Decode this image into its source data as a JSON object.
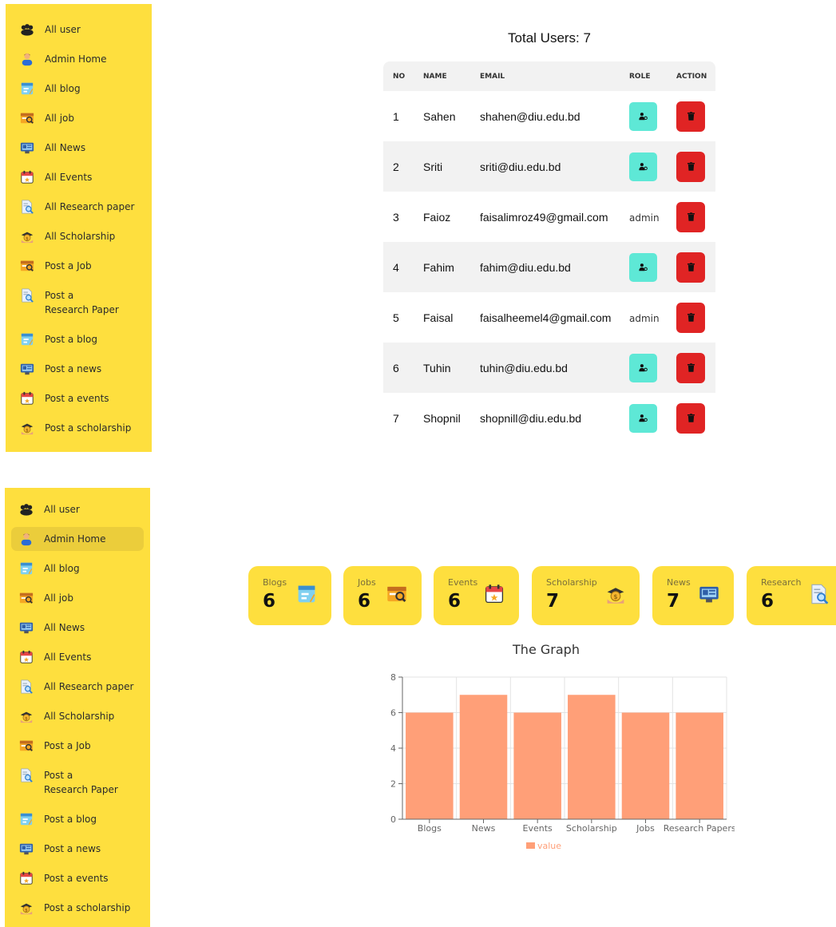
{
  "sidebar_top": {
    "items": [
      {
        "label": "All user",
        "icon": "users-group-icon"
      },
      {
        "label": "Admin Home",
        "icon": "admin-person-icon"
      },
      {
        "label": "All blog",
        "icon": "blog-icon"
      },
      {
        "label": "All job",
        "icon": "job-icon"
      },
      {
        "label": "All News",
        "icon": "news-icon"
      },
      {
        "label": "All Events",
        "icon": "calendar-icon"
      },
      {
        "label": "All Research paper",
        "icon": "research-icon"
      },
      {
        "label": "All Scholarship",
        "icon": "scholarship-icon"
      },
      {
        "label": "Post a Job",
        "icon": "job-icon"
      },
      {
        "label": "Post a Research Paper",
        "icon": "research-icon"
      },
      {
        "label": "Post a blog",
        "icon": "blog-icon"
      },
      {
        "label": "Post a news",
        "icon": "news-icon"
      },
      {
        "label": "Post a events",
        "icon": "calendar-icon"
      },
      {
        "label": "Post a scholarship",
        "icon": "scholarship-icon"
      }
    ]
  },
  "sidebar_bottom": {
    "active_index": 1,
    "items": [
      {
        "label": "All user",
        "icon": "users-group-icon"
      },
      {
        "label": "Admin Home",
        "icon": "admin-person-icon"
      },
      {
        "label": "All blog",
        "icon": "blog-icon"
      },
      {
        "label": "All job",
        "icon": "job-icon"
      },
      {
        "label": "All News",
        "icon": "news-icon"
      },
      {
        "label": "All Events",
        "icon": "calendar-icon"
      },
      {
        "label": "All Research paper",
        "icon": "research-icon"
      },
      {
        "label": "All Scholarship",
        "icon": "scholarship-icon"
      },
      {
        "label": "Post a Job",
        "icon": "job-icon"
      },
      {
        "label": "Post a Research Paper",
        "icon": "research-icon"
      },
      {
        "label": "Post a blog",
        "icon": "blog-icon"
      },
      {
        "label": "Post a news",
        "icon": "news-icon"
      },
      {
        "label": "Post a events",
        "icon": "calendar-icon"
      },
      {
        "label": "Post a scholarship",
        "icon": "scholarship-icon"
      }
    ]
  },
  "users": {
    "title": "Total Users: 7",
    "columns": [
      "NO",
      "NAME",
      "EMAIL",
      "ROLE",
      "ACTION"
    ],
    "rows": [
      {
        "no": "1",
        "name": "Sahen",
        "email": "shahen@diu.edu.bd",
        "role": ""
      },
      {
        "no": "2",
        "name": "Sriti",
        "email": "sriti@diu.edu.bd",
        "role": ""
      },
      {
        "no": "3",
        "name": "Faioz",
        "email": "faisalimroz49@gmail.com",
        "role": "admin"
      },
      {
        "no": "4",
        "name": "Fahim",
        "email": "fahim@diu.edu.bd",
        "role": ""
      },
      {
        "no": "5",
        "name": "Faisal",
        "email": "faisalheemel4@gmail.com",
        "role": "admin"
      },
      {
        "no": "6",
        "name": "Tuhin",
        "email": "tuhin@diu.edu.bd",
        "role": ""
      },
      {
        "no": "7",
        "name": "Shopnil",
        "email": "shopnill@diu.edu.bd",
        "role": ""
      }
    ]
  },
  "stats": [
    {
      "label": "Blogs",
      "value": "6",
      "icon": "blog-icon"
    },
    {
      "label": "Jobs",
      "value": "6",
      "icon": "job-icon"
    },
    {
      "label": "Events",
      "value": "6",
      "icon": "calendar-icon"
    },
    {
      "label": "Scholarship",
      "value": "7",
      "icon": "scholarship-icon"
    },
    {
      "label": "News",
      "value": "7",
      "icon": "news-icon"
    },
    {
      "label": "Research",
      "value": "6",
      "icon": "research-icon"
    }
  ],
  "colors": {
    "sidebar_bg": "#fedf3e",
    "bar": "#ff9f78",
    "role_button": "#5ee8d6",
    "delete_button": "#e02424"
  },
  "chart_title": "The Graph",
  "chart_data": {
    "type": "bar",
    "title": "The Graph",
    "categories": [
      "Blogs",
      "News",
      "Events",
      "Scholarship",
      "Jobs",
      "Research Papers"
    ],
    "series": [
      {
        "name": "value",
        "values": [
          6,
          7,
          6,
          7,
          6,
          6
        ]
      }
    ],
    "ylim": [
      0,
      8
    ],
    "yticks": [
      "0",
      "2",
      "4",
      "6",
      "8"
    ],
    "grid": true,
    "legend": "bottom"
  }
}
